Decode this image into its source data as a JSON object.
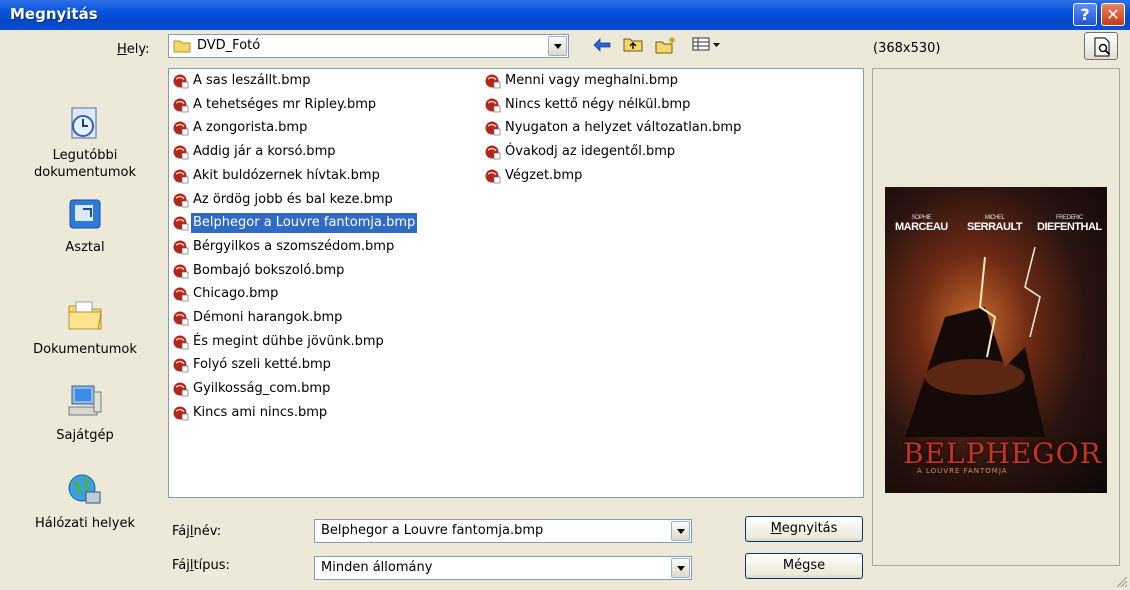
{
  "window": {
    "title": "Megnyitás",
    "help_glyph": "?",
    "close_glyph": "✕"
  },
  "lookin": {
    "label_pre": "",
    "label_key": "H",
    "label_post": "ely:",
    "value": "DVD_Fotó"
  },
  "toolbar": {
    "back_icon": "back-arrow-icon",
    "up_icon": "up-folder-icon",
    "newfolder_icon": "new-folder-icon",
    "views_icon": "views-menu-icon"
  },
  "preview": {
    "size": "(368x530)",
    "poster": {
      "names": [
        {
          "first": "SOPHIE",
          "last": "MARCEAU"
        },
        {
          "first": "MICHEL",
          "last": "SERRAULT"
        },
        {
          "first": "FREDERIC",
          "last": "DIEFENTHAL"
        }
      ],
      "title": "BELPHEGOR",
      "subtitle": "A LOUVRE FANTOMJA"
    }
  },
  "places": [
    {
      "label": "Legutóbbi dokumentumok",
      "icon": "recent-documents-icon"
    },
    {
      "label": "Asztal",
      "icon": "desktop-icon"
    },
    {
      "label": "Dokumentumok",
      "icon": "my-documents-icon"
    },
    {
      "label": "Sajátgép",
      "icon": "my-computer-icon"
    },
    {
      "label": "Hálózati helyek",
      "icon": "network-places-icon"
    }
  ],
  "files": {
    "col1": [
      "A sas leszállt.bmp",
      "A tehetséges mr Ripley.bmp",
      "A zongorista.bmp",
      "Addig jár a korsó.bmp",
      "Akit buldózernek hívtak.bmp",
      "Az ördög jobb és bal keze.bmp",
      "Belphegor a Louvre fantomja.bmp",
      "Bérgyilkos a szomszédom.bmp",
      "Bombajó bokszoló.bmp",
      "Chicago.bmp",
      "Démoni harangok.bmp",
      "És megint dühbe jövünk.bmp",
      "Folyó szeli ketté.bmp",
      "Gyilkosság_com.bmp",
      "Kincs ami nincs.bmp"
    ],
    "col2": [
      "Menni vagy meghalni.bmp",
      "Nincs kettő négy nélkül.bmp",
      "Nyugaton a helyzet változatlan.bmp",
      "Óvakodj az idegentől.bmp",
      "Végzet.bmp"
    ],
    "selected": "Belphegor a Louvre fantomja.bmp"
  },
  "filename": {
    "label_pre": "Fáj",
    "label_key": "l",
    "label_post": "név:",
    "value": "Belphegor a Louvre fantomja.bmp"
  },
  "filetype": {
    "label_pre": "Fáj",
    "label_key": "l",
    "label_post": "típus:",
    "value": "Minden állomány"
  },
  "buttons": {
    "open_key": "M",
    "open_rest": "egnyitás",
    "cancel": "Mégse"
  }
}
